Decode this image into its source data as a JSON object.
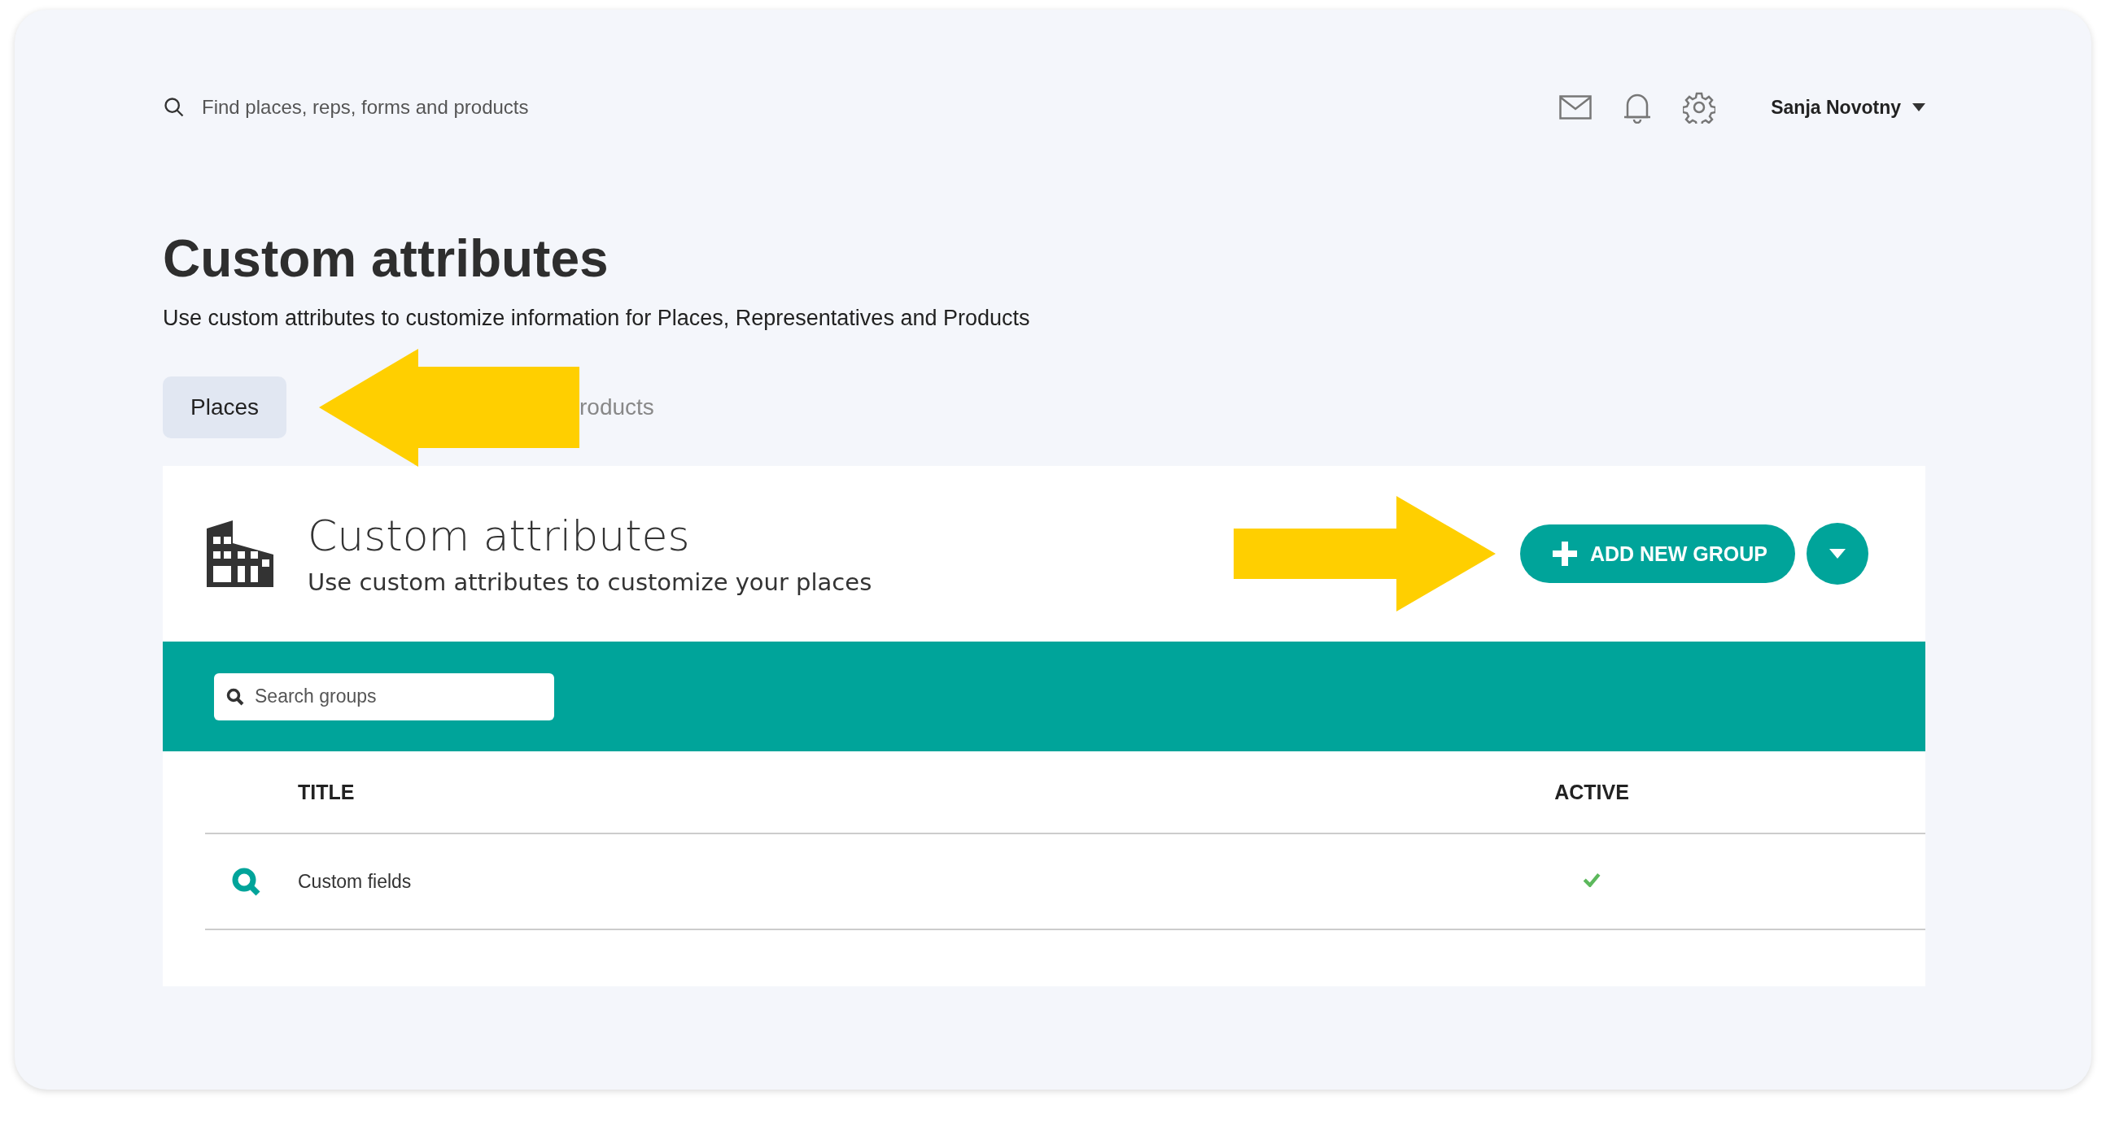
{
  "search": {
    "placeholder": "Find places, reps, forms and products"
  },
  "user": {
    "name": "Sanja Novotny"
  },
  "page": {
    "title": "Custom attributes",
    "subtitle": "Use custom attributes to customize information for Places, Representatives and Products"
  },
  "tabs": [
    {
      "label": "Places",
      "selected": true
    },
    {
      "label": "roducts",
      "selected": false
    }
  ],
  "panel": {
    "title": "Custom attributes",
    "subtitle": "Use custom attributes to customize your places",
    "add_button": "ADD NEW GROUP",
    "search": {
      "placeholder": "Search groups"
    }
  },
  "table": {
    "columns": [
      "TITLE",
      "ACTIVE"
    ],
    "rows": [
      {
        "title": "Custom fields",
        "active": true
      }
    ]
  }
}
